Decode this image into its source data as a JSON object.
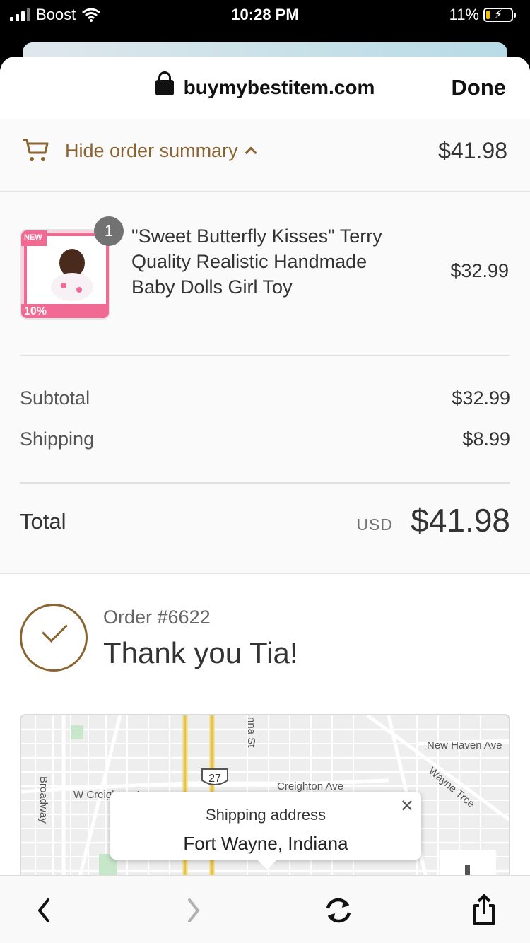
{
  "status_bar": {
    "carrier": "Boost",
    "time": "10:28 PM",
    "battery_pct": "11%"
  },
  "browser": {
    "url": "buymybestitem.com",
    "done_label": "Done"
  },
  "summary_toggle": {
    "label": "Hide order summary",
    "total": "$41.98"
  },
  "product": {
    "quantity": "1",
    "name": "\"Sweet Butterfly Kisses\" Terry Quality Realistic Handmade Baby Dolls Girl Toy",
    "price": "$32.99",
    "thumb_badge_new": "NEW",
    "thumb_badge_discount": "10%"
  },
  "totals": {
    "subtotal_label": "Subtotal",
    "subtotal": "$32.99",
    "shipping_label": "Shipping",
    "shipping": "$8.99",
    "total_label": "Total",
    "currency": "USD",
    "total": "$41.98"
  },
  "confirmation": {
    "order_number": "Order #6622",
    "thank_you": "Thank you Tia!"
  },
  "map": {
    "streets": [
      "Broadway",
      "W Creighton Ave",
      "Creighton Ave",
      "New Haven Ave",
      "Wayne Trce",
      "nna St"
    ],
    "route_shield": "27",
    "popup_title": "Shipping address",
    "popup_location": "Fort Wayne, Indiana"
  },
  "colors": {
    "accent": "#8a6431",
    "text": "#333333",
    "background": "#fafafa"
  }
}
